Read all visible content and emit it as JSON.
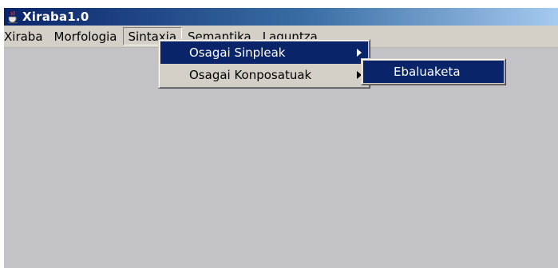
{
  "window": {
    "title": "Xiraba1.0"
  },
  "menubar": [
    {
      "label": "Xiraba"
    },
    {
      "label": "Morfologia"
    },
    {
      "label": "Sintaxia"
    },
    {
      "label": "Semantika"
    },
    {
      "label": "Laguntza"
    }
  ],
  "dropdown": {
    "items": [
      {
        "label": "Osagai Sinpleak"
      },
      {
        "label": "Osagai Konposatuak"
      }
    ]
  },
  "submenu": {
    "items": [
      {
        "label": "Ebaluaketa"
      }
    ]
  },
  "colors": {
    "selection": "#0a246a",
    "menu_bg": "#d4d0c8",
    "client_bg": "#c3c2c7"
  },
  "icons": {
    "app": "java-coffee-cup-icon"
  }
}
